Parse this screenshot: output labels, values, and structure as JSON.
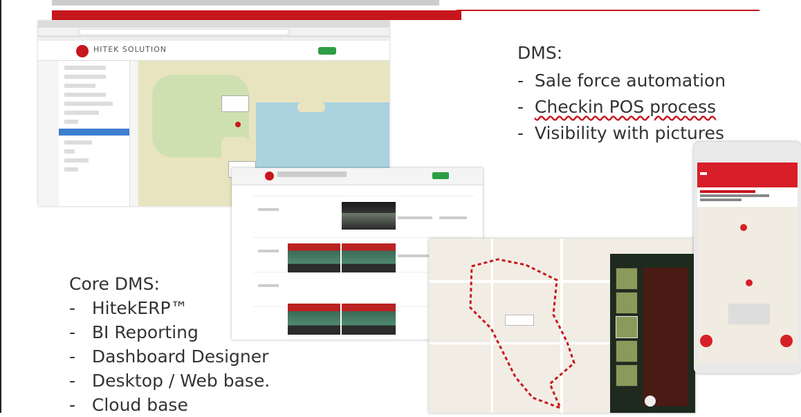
{
  "dms": {
    "heading": "DMS:",
    "items": [
      "Sale force automation",
      "Checkin POS process",
      "Visibility with pictures"
    ]
  },
  "core": {
    "heading": "Core DMS:",
    "items": [
      "HitekERP™",
      "BI Reporting",
      "Dashboard Designer",
      "Desktop / Web base.",
      "Cloud base"
    ]
  },
  "colors": {
    "accent": "#c8161d",
    "text": "#333333",
    "map_water": "#aad3df",
    "ok_green": "#2e9e44"
  },
  "screenshots": {
    "browser_map": {
      "brand": "HITEK SOLUTION",
      "icon": "map-view"
    },
    "visit_table": {
      "icon": "photo-grid"
    },
    "route_map": {
      "icon": "route-trace"
    },
    "phone_app": {
      "icon": "mobile-checkin"
    }
  }
}
